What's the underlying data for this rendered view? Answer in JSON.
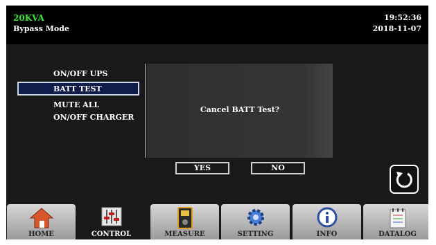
{
  "header": {
    "model": "20KVA",
    "mode": "Bypass Mode",
    "time": "19:52:36",
    "date": "2018-11-07"
  },
  "menu": {
    "items": [
      {
        "label": "ON/OFF UPS"
      },
      {
        "label": "BATT TEST"
      },
      {
        "label": "MUTE ALL"
      },
      {
        "label": "ON/OFF CHARGER"
      }
    ],
    "selected": "BATT TEST"
  },
  "dialog": {
    "message": "Cancel BATT Test?",
    "yes_label": "YES",
    "no_label": "NO"
  },
  "tabs": [
    {
      "label": "HOME",
      "icon": "home-icon"
    },
    {
      "label": "CONTROL",
      "icon": "sliders-icon"
    },
    {
      "label": "MEASURE",
      "icon": "meter-icon"
    },
    {
      "label": "SETTING",
      "icon": "gear-icon"
    },
    {
      "label": "INFO",
      "icon": "info-icon"
    },
    {
      "label": "DATALOG",
      "icon": "notepad-icon"
    }
  ],
  "active_tab": "CONTROL",
  "colors": {
    "model_text": "#39e639",
    "screen_bg": "#191919",
    "selection_bg": "#101c4a"
  }
}
